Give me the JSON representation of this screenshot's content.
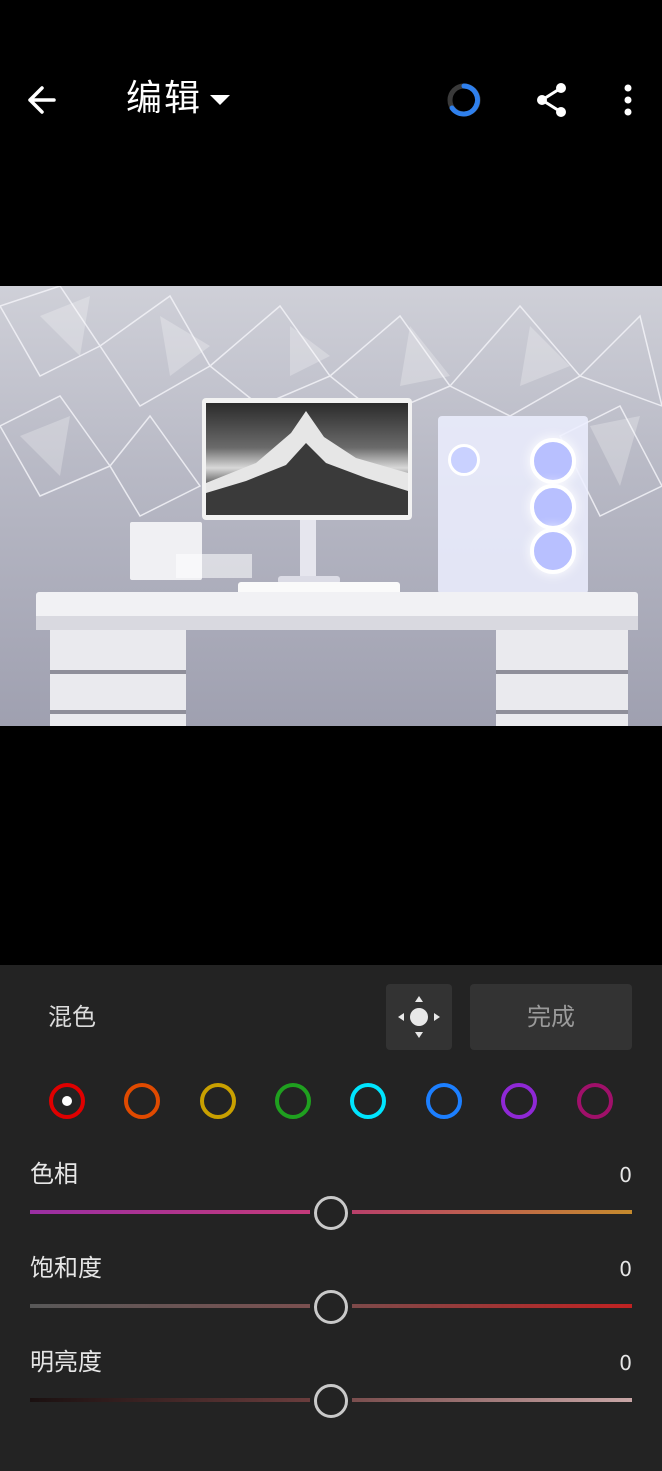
{
  "header": {
    "title": "编辑",
    "back_icon": "arrow-left-icon",
    "dropdown_icon": "caret-down-icon",
    "spinner_icon": "loading-spinner-icon",
    "share_icon": "share-icon",
    "more_icon": "more-vertical-icon",
    "spinner_color": "#2f80ed"
  },
  "photo": {
    "description_icon": "photo-preview"
  },
  "panel": {
    "section_label": "混色",
    "target_icon": "target-adjust-icon",
    "done_label": "完成",
    "swatches": [
      {
        "name": "red",
        "color": "#e00000",
        "selected": true
      },
      {
        "name": "orange",
        "color": "#e04a00",
        "selected": false
      },
      {
        "name": "yellow",
        "color": "#c9a000",
        "selected": false
      },
      {
        "name": "green",
        "color": "#1fa01f",
        "selected": false
      },
      {
        "name": "aqua",
        "color": "#00e5ff",
        "selected": false
      },
      {
        "name": "blue",
        "color": "#1c7fff",
        "selected": false
      },
      {
        "name": "purple",
        "color": "#8f28d6",
        "selected": false
      },
      {
        "name": "magenta",
        "color": "#a0106a",
        "selected": false
      }
    ],
    "sliders": [
      {
        "label": "色相",
        "value": "0",
        "left_gradient": [
          "#9a2fa3",
          "#c33a7a"
        ],
        "right_gradient": [
          "#b8406a",
          "#c58a2d"
        ]
      },
      {
        "label": "饱和度",
        "value": "0",
        "left_gradient": [
          "#585858",
          "#7a5050"
        ],
        "right_gradient": [
          "#7d4a4a",
          "#c02222"
        ]
      },
      {
        "label": "明亮度",
        "value": "0",
        "left_gradient": [
          "#1a1010",
          "#6a3d3d"
        ],
        "right_gradient": [
          "#7a4e4e",
          "#c8a6a6"
        ]
      }
    ]
  }
}
